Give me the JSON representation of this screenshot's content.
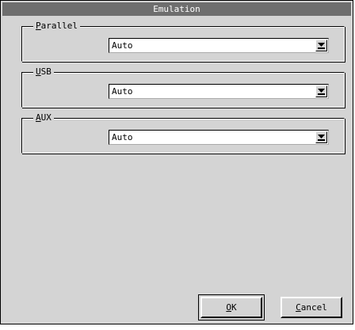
{
  "window": {
    "title": "Emulation"
  },
  "groups": [
    {
      "label_underlined": "P",
      "label_rest": "arallel",
      "value": "Auto"
    },
    {
      "label_underlined": "U",
      "label_rest": "SB",
      "value": "Auto"
    },
    {
      "label_underlined": "A",
      "label_rest": "UX",
      "value": "Auto"
    }
  ],
  "buttons": {
    "ok": {
      "underlined": "O",
      "rest": "K"
    },
    "cancel": {
      "underlined": "C",
      "rest": "ancel"
    }
  },
  "colors": {
    "window_bg": "#d4d4d4",
    "titlebar_bg": "#6e6e6e",
    "field_bg": "#ffffff"
  },
  "icons": {
    "dropdown": "dropdown-arrow-icon"
  }
}
